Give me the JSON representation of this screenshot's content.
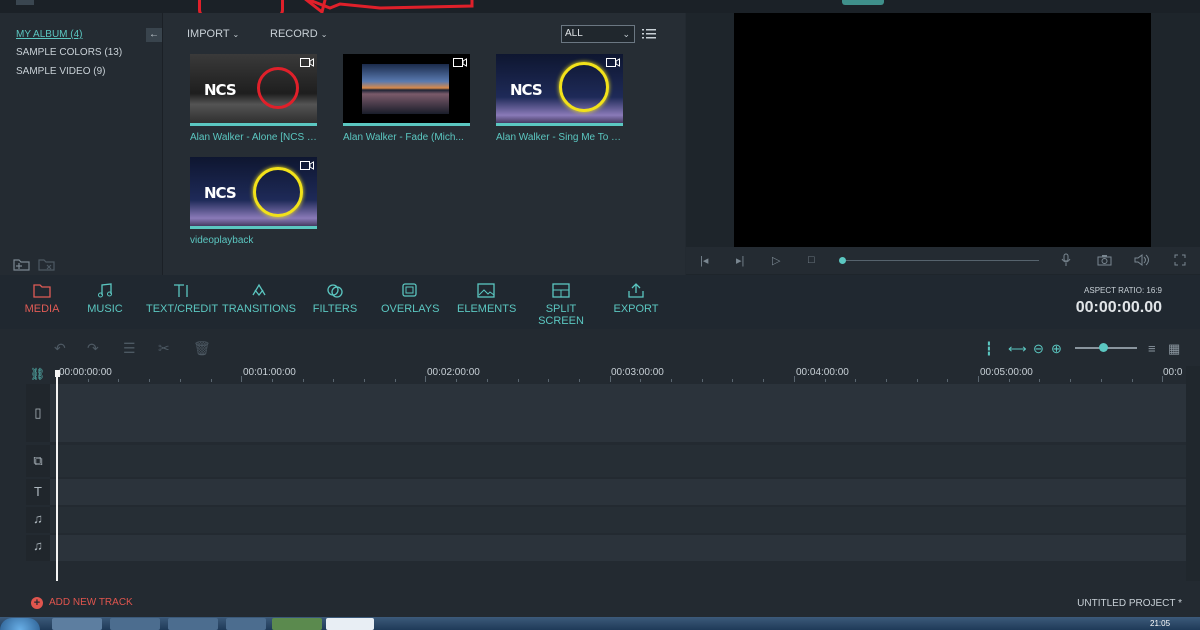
{
  "album": {
    "items": [
      {
        "label": "MY ALBUM (4)",
        "selected": true
      },
      {
        "label": "SAMPLE COLORS (13)",
        "selected": false
      },
      {
        "label": "SAMPLE VIDEO (9)",
        "selected": false
      }
    ],
    "back_icon": "arrow-left-icon"
  },
  "library": {
    "import_label": "IMPORT",
    "record_label": "RECORD",
    "filter_value": "ALL",
    "items": [
      {
        "caption": "Alan Walker - Alone [NCS Release]"
      },
      {
        "caption": "Alan Walker - Fade (Mich..."
      },
      {
        "caption": "Alan Walker - Sing Me To S..."
      },
      {
        "caption": "videoplayback"
      }
    ],
    "thumb_text": "NCS"
  },
  "toolbar": {
    "tools": [
      {
        "label": "MEDIA",
        "icon": "folder-icon",
        "active": true
      },
      {
        "label": "MUSIC",
        "icon": "music-note-icon"
      },
      {
        "label": "TEXT/CREDIT",
        "icon": "text-icon"
      },
      {
        "label": "TRANSITIONS",
        "icon": "transitions-icon"
      },
      {
        "label": "FILTERS",
        "icon": "filters-icon"
      },
      {
        "label": "OVERLAYS",
        "icon": "overlays-icon"
      },
      {
        "label": "ELEMENTS",
        "icon": "image-icon"
      },
      {
        "label": "SPLIT SCREEN",
        "icon": "split-screen-icon"
      },
      {
        "label": "EXPORT",
        "icon": "export-icon"
      }
    ],
    "aspect_ratio": "ASPECT RATIO: 16:9",
    "timecode": "00:00:00.00"
  },
  "timeline": {
    "ruler": [
      "00:00:00:00",
      "00:01:00:00",
      "00:02:00:00",
      "00:03:00:00",
      "00:04:00:00",
      "00:05:00:00",
      "00:0"
    ],
    "add_track": "ADD NEW TRACK",
    "project_name": "UNTITLED PROJECT *"
  },
  "taskbar": {
    "clock": "21:05"
  },
  "colors": {
    "accent": "#5bc7c1",
    "active": "#e05b55",
    "annotation": "#e0202a"
  }
}
